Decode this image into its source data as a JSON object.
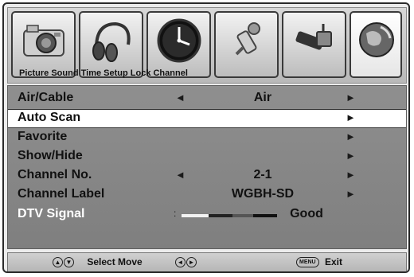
{
  "tabs": [
    {
      "label": "Picture",
      "icon": "camera-icon"
    },
    {
      "label": "Sound",
      "icon": "headphones-icon"
    },
    {
      "label": "Time",
      "icon": "clock-icon"
    },
    {
      "label": "Setup",
      "icon": "setup-tools-icon"
    },
    {
      "label": "Lock",
      "icon": "lock-connector-icon"
    },
    {
      "label": "Channel",
      "icon": "globe-icon"
    }
  ],
  "tab_strip_text": "Picture Sound Time Setup Lock Channel",
  "selected_tab": "Channel",
  "menu": {
    "rows": [
      {
        "label": "Air/Cable",
        "value": "Air",
        "left_arrow": "◄",
        "right_arrow": "►"
      },
      {
        "label": "Auto Scan",
        "value": "",
        "left_arrow": "",
        "right_arrow": "►",
        "highlighted": true
      },
      {
        "label": "Favorite",
        "value": "",
        "left_arrow": "",
        "right_arrow": "►"
      },
      {
        "label": "Show/Hide",
        "value": "",
        "left_arrow": "",
        "right_arrow": "►"
      },
      {
        "label": "Channel No.",
        "value": "2-1",
        "left_arrow": "◄",
        "right_arrow": "►"
      },
      {
        "label": "Channel Label",
        "value": "WGBH-SD",
        "left_arrow": "",
        "right_arrow": "►"
      }
    ],
    "signal": {
      "label": "DTV Signal",
      "colon": ":",
      "value": "Good"
    }
  },
  "help": {
    "select_move_label": "Select Move",
    "up_down_glyph": "▲▼",
    "left_right_glyph": "◄►",
    "menu_key": "MENU",
    "exit_label": "Exit"
  },
  "colors": {
    "highlight": "#ffffff",
    "menu_bg": "#878787",
    "dim_text": "#ffffff"
  }
}
